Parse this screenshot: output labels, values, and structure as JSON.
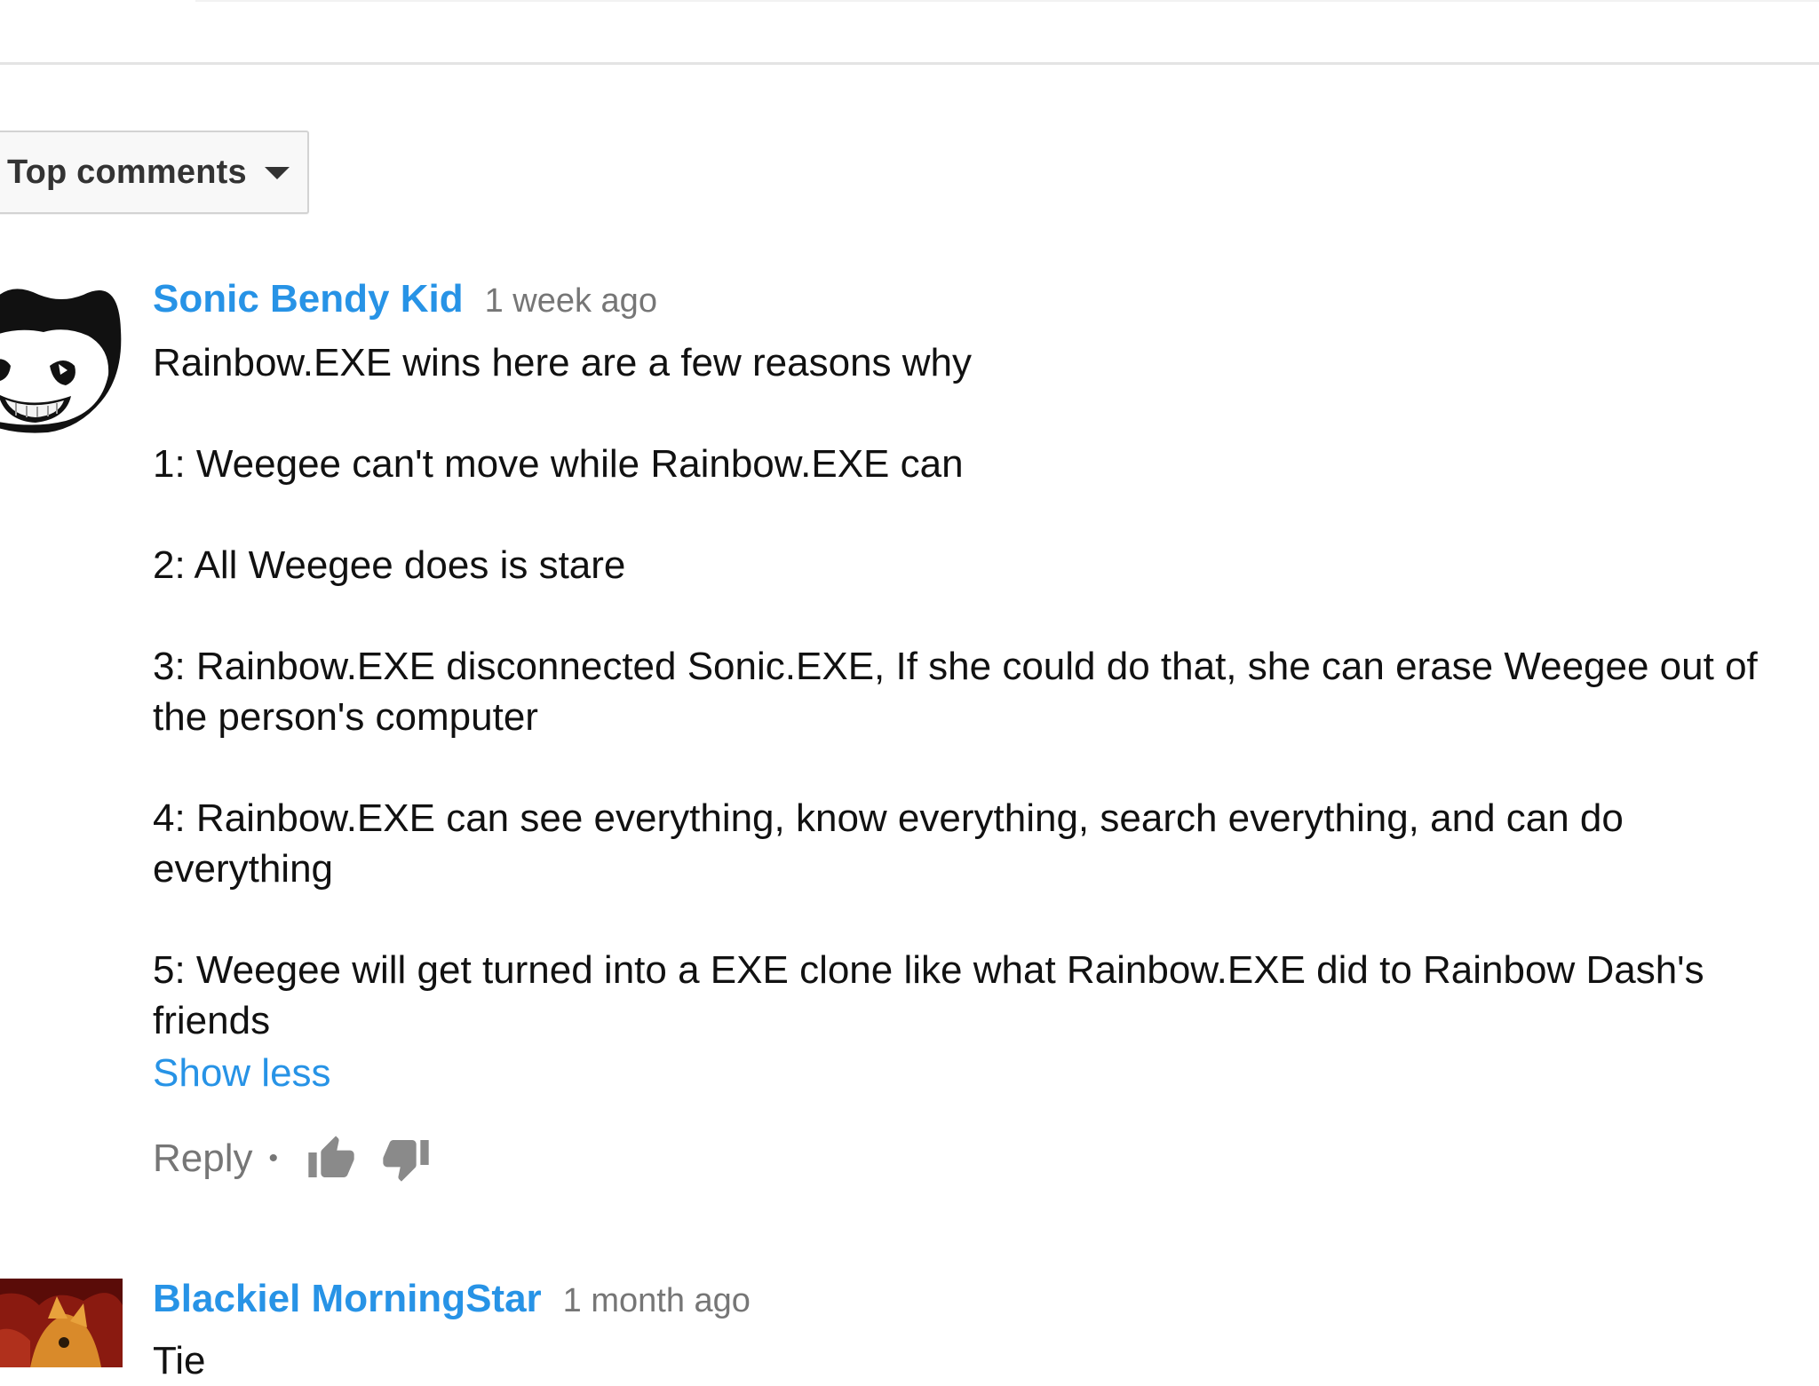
{
  "sort": {
    "label": "Top comments",
    "caret_icon": "caret-down-icon"
  },
  "comments": [
    {
      "author": "Sonic Bendy Kid",
      "time": "1 week ago",
      "avatar_icon": "bendy-face-avatar",
      "text": "Rainbow.EXE wins here are a few reasons why\n\n1: Weegee can't move while Rainbow.EXE can\n\n2: All Weegee does is stare\n\n3: Rainbow.EXE disconnected Sonic.EXE, If she could do that, she can erase Weegee out of the person's computer\n\n4: Rainbow.EXE can see everything, know everything, search everything, and can do everything\n\n5: Weegee will get turned into a EXE clone like what Rainbow.EXE did to Rainbow Dash's friends",
      "show_less": "Show less",
      "reply": "Reply",
      "separator": "•",
      "like_icon": "thumbs-up-icon",
      "dislike_icon": "thumbs-down-icon"
    },
    {
      "author": "Blackiel MorningStar",
      "time": "1 month ago",
      "avatar_icon": "character-avatar",
      "text": "Tie"
    }
  ],
  "colors": {
    "link": "#2793e6",
    "meta": "#767676",
    "text": "#111111",
    "divider": "#e4e4e4"
  }
}
